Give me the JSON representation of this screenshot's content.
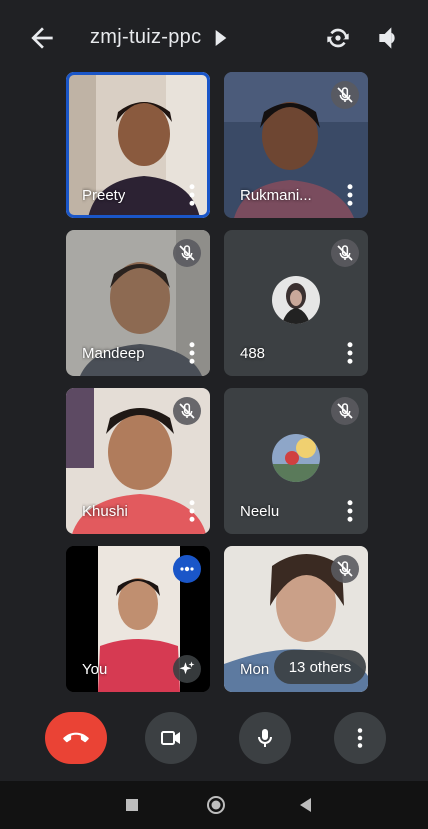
{
  "header": {
    "meeting_code": "zmj-tuiz-ppc",
    "icons": [
      "arrow-back-icon",
      "caret-right-icon",
      "switch-camera-icon",
      "volume-icon"
    ]
  },
  "participants": [
    {
      "name": "Preety",
      "muted": false,
      "active_speaker": true,
      "kind": "video"
    },
    {
      "name": "Rukmani...",
      "muted": true,
      "kind": "video"
    },
    {
      "name": "Mandeep",
      "muted": true,
      "kind": "video"
    },
    {
      "name": "488",
      "muted": true,
      "kind": "avatar"
    },
    {
      "name": "Khushi",
      "muted": true,
      "kind": "video"
    },
    {
      "name": "Neelu",
      "muted": true,
      "kind": "avatar"
    },
    {
      "name": "You",
      "muted": false,
      "kind": "video"
    },
    {
      "name": "Mon",
      "muted": true,
      "kind": "video"
    }
  ],
  "others_label": "13 others",
  "controls": {
    "icons": [
      "end-call-icon",
      "camera-icon",
      "microphone-icon",
      "more-options-icon"
    ],
    "colors": {
      "end_call": "#ea4335",
      "button": "#3c4043",
      "active_outline": "#1a56c8",
      "speaking": "#1a56c8"
    }
  },
  "navigation": {
    "icons": [
      "recents-square-icon",
      "home-circle-icon",
      "back-triangle-icon"
    ]
  }
}
